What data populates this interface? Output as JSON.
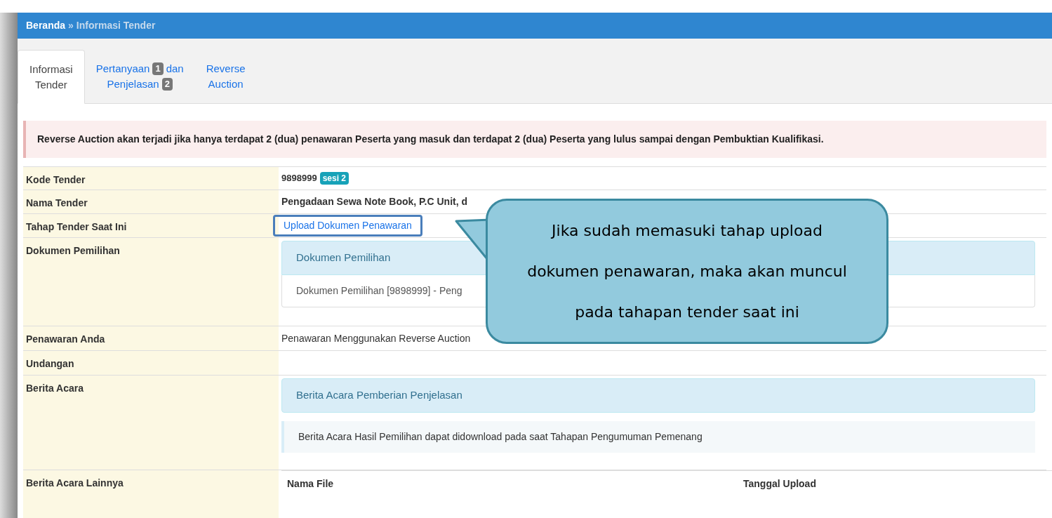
{
  "breadcrumb": [
    {
      "label": "Beranda",
      "selected": false
    },
    {
      "label": "Informasi Tender",
      "selected": true
    }
  ],
  "breadcrumb_separator": "»",
  "tabs": [
    {
      "selected": true,
      "lines": [
        [
          {
            "kind": "text",
            "text": "Informasi"
          }
        ],
        [
          {
            "kind": "text",
            "text": "Tender"
          }
        ]
      ]
    },
    {
      "selected": false,
      "lines": [
        [
          {
            "kind": "text",
            "text": "Pertanyaan"
          },
          {
            "kind": "badge",
            "text": "1"
          },
          {
            "kind": "text",
            "text": "dan"
          }
        ],
        [
          {
            "kind": "text",
            "text": "Penjelasan"
          },
          {
            "kind": "badge",
            "text": "2"
          }
        ]
      ]
    },
    {
      "selected": false,
      "lines": [
        [
          {
            "kind": "text",
            "text": "Reverse"
          }
        ],
        [
          {
            "kind": "text",
            "text": "Auction"
          }
        ]
      ]
    }
  ],
  "alert": "Reverse Auction akan terjadi jika hanya terdapat 2 (dua) penawaran Peserta yang masuk dan terdapat 2 (dua) Peserta yang lulus sampai dengan Pembuktian Kualifikasi.",
  "rows": [
    {
      "label": "Kode Tender",
      "kind": "code",
      "value": "9898999",
      "badge": "sesi 2"
    },
    {
      "label": "Nama Tender",
      "kind": "bold",
      "value": "Pengadaan Sewa Note Book, P.C Unit, d"
    },
    {
      "label": "Tahap Tender Saat Ini",
      "kind": "link",
      "value": "Upload Dokumen Penawaran"
    },
    {
      "label": "Dokumen Pemilihan",
      "kind": "panel",
      "heading": "Dokumen Pemilihan",
      "body": "Dokumen Pemilihan [9898999] - Peng"
    },
    {
      "label": "Penawaran Anda",
      "kind": "text",
      "value": "Penawaran Menggunakan Reverse Auction"
    },
    {
      "label": "Undangan",
      "kind": "empty"
    },
    {
      "label": "Berita Acara",
      "kind": "panel_note",
      "heading": "Berita Acara Pemberian Penjelasan",
      "note": "Berita Acara Hasil Pemilihan dapat didownload pada saat Tahapan Pengumuman Pemenang"
    },
    {
      "label": "Berita Acara Lainnya",
      "kind": "table",
      "columns": [
        "Nama File",
        "Tanggal Upload"
      ]
    }
  ],
  "callout": {
    "text": "Jika sudah memasuki tahap upload dokumen penawaran, maka akan muncul pada tahapan tender saat ini"
  }
}
